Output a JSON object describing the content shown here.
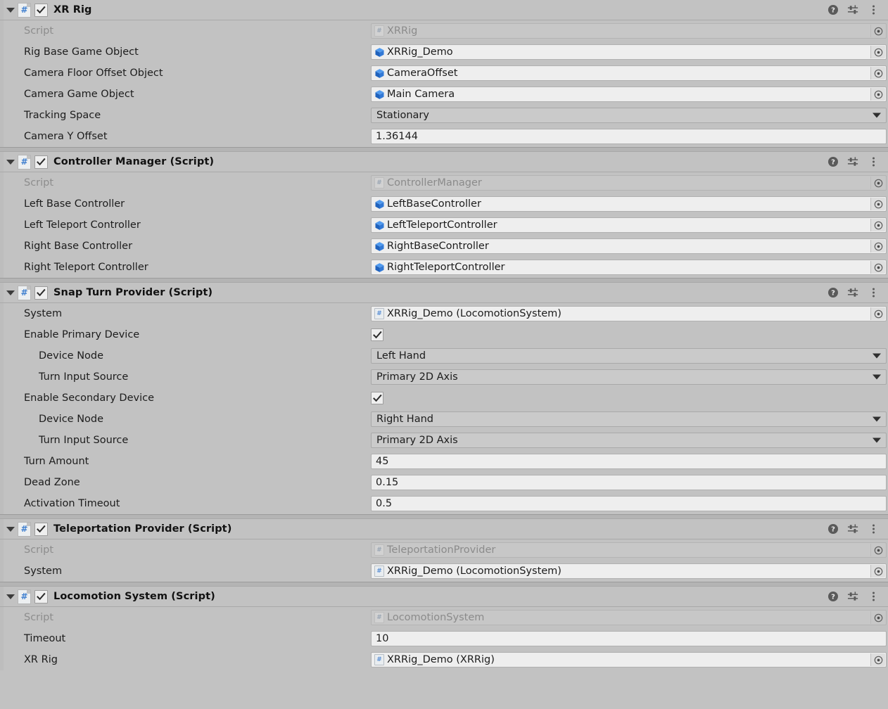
{
  "colors": {
    "panel_bg": "#c2c2c2",
    "field_bg": "#eeeeee",
    "dropdown_bg": "#cacaca",
    "accent_blue": "#3f7fcf",
    "cube_blue": "#2b78d4",
    "disabled_text": "#8d8d8d"
  },
  "header_icons": {
    "help": "help-icon",
    "preset": "preset-icon",
    "menu": "kebab-menu-icon"
  },
  "components": [
    {
      "title": "XR Rig",
      "enabled": true,
      "expanded": true,
      "rows": [
        {
          "label": "Script",
          "type": "object",
          "icon": "script-hash-icon",
          "value": "XRRig",
          "disabled": true,
          "indent": false
        },
        {
          "label": "Rig Base Game Object",
          "type": "object",
          "icon": "gameobject-cube-icon",
          "value": "XRRig_Demo",
          "disabled": false,
          "indent": false
        },
        {
          "label": "Camera Floor Offset Object",
          "type": "object",
          "icon": "gameobject-cube-icon",
          "value": "CameraOffset",
          "disabled": false,
          "indent": false
        },
        {
          "label": "Camera Game Object",
          "type": "object",
          "icon": "gameobject-cube-icon",
          "value": "Main Camera",
          "disabled": false,
          "indent": false
        },
        {
          "label": "Tracking Space",
          "type": "dropdown",
          "value": "Stationary",
          "indent": false
        },
        {
          "label": "Camera Y Offset",
          "type": "text",
          "value": "1.36144",
          "indent": false
        }
      ]
    },
    {
      "title": "Controller Manager (Script)",
      "enabled": true,
      "expanded": true,
      "rows": [
        {
          "label": "Script",
          "type": "object",
          "icon": "script-hash-icon",
          "value": "ControllerManager",
          "disabled": true,
          "indent": false
        },
        {
          "label": "Left Base Controller",
          "type": "object",
          "icon": "gameobject-cube-icon",
          "value": "LeftBaseController",
          "disabled": false,
          "indent": false
        },
        {
          "label": "Left Teleport Controller",
          "type": "object",
          "icon": "gameobject-cube-icon",
          "value": "LeftTeleportController",
          "disabled": false,
          "indent": false
        },
        {
          "label": "Right Base Controller",
          "type": "object",
          "icon": "gameobject-cube-icon",
          "value": "RightBaseController",
          "disabled": false,
          "indent": false
        },
        {
          "label": "Right Teleport Controller",
          "type": "object",
          "icon": "gameobject-cube-icon",
          "value": "RightTeleportController",
          "disabled": false,
          "indent": false
        }
      ]
    },
    {
      "title": "Snap Turn Provider (Script)",
      "enabled": true,
      "expanded": true,
      "rows": [
        {
          "label": "System",
          "type": "object",
          "icon": "script-hash-icon",
          "value": "XRRig_Demo (LocomotionSystem)",
          "disabled": false,
          "indent": false
        },
        {
          "label": "Enable Primary Device",
          "type": "checkbox",
          "checked": true,
          "indent": false
        },
        {
          "label": "Device Node",
          "type": "dropdown",
          "value": "Left Hand",
          "indent": true
        },
        {
          "label": "Turn Input Source",
          "type": "dropdown",
          "value": "Primary 2D Axis",
          "indent": true
        },
        {
          "label": "Enable Secondary Device",
          "type": "checkbox",
          "checked": true,
          "indent": false
        },
        {
          "label": "Device Node",
          "type": "dropdown",
          "value": "Right Hand",
          "indent": true
        },
        {
          "label": "Turn Input Source",
          "type": "dropdown",
          "value": "Primary 2D Axis",
          "indent": true
        },
        {
          "label": "Turn Amount",
          "type": "text",
          "value": "45",
          "indent": false
        },
        {
          "label": "Dead Zone",
          "type": "text",
          "value": "0.15",
          "indent": false
        },
        {
          "label": "Activation Timeout",
          "type": "text",
          "value": "0.5",
          "indent": false
        }
      ]
    },
    {
      "title": "Teleportation Provider (Script)",
      "enabled": true,
      "expanded": true,
      "rows": [
        {
          "label": "Script",
          "type": "object",
          "icon": "script-hash-icon",
          "value": "TeleportationProvider",
          "disabled": true,
          "indent": false
        },
        {
          "label": "System",
          "type": "object",
          "icon": "script-hash-icon",
          "value": "XRRig_Demo (LocomotionSystem)",
          "disabled": false,
          "indent": false
        }
      ]
    },
    {
      "title": "Locomotion System (Script)",
      "enabled": true,
      "expanded": true,
      "rows": [
        {
          "label": "Script",
          "type": "object",
          "icon": "script-hash-icon",
          "value": "LocomotionSystem",
          "disabled": true,
          "indent": false
        },
        {
          "label": "Timeout",
          "type": "text",
          "value": "10",
          "indent": false
        },
        {
          "label": "XR Rig",
          "type": "object",
          "icon": "script-hash-icon",
          "value": "XRRig_Demo (XRRig)",
          "disabled": false,
          "indent": false
        }
      ]
    }
  ]
}
